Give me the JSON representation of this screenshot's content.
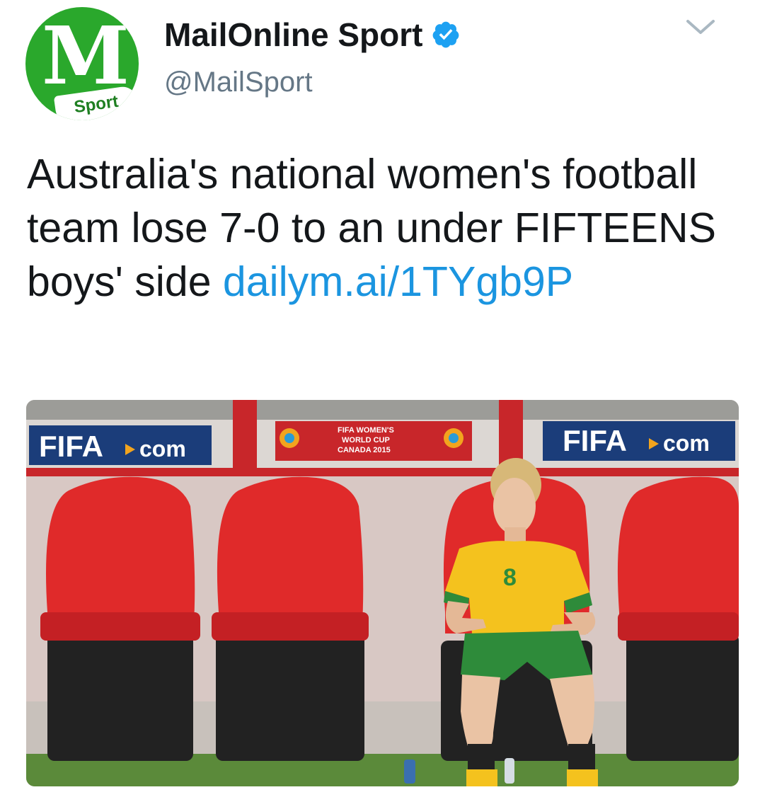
{
  "account": {
    "avatar_label": "Sport",
    "display_name": "MailOnline Sport",
    "handle": "@MailSport",
    "brand_color": "#2aa82c"
  },
  "tweet": {
    "text_before_link": "Australia's national women's football team lose 7-0 to an under FIFTEENS boys' side ",
    "link_text": "dailym.ai/​1TYgb9P",
    "link_color": "#1b95e0"
  },
  "photo": {
    "board_left": "FIFA",
    "board_left_suffix": "com",
    "board_right": "FIFA",
    "board_right_suffix": "com",
    "board_center_line1": "FIFA WOMEN'S",
    "board_center_line2": "WORLD CUP",
    "board_center_line3": "CANADA 2015",
    "jersey_number": "8"
  },
  "icons": {
    "verified": "verified-badge-icon",
    "menu": "chevron-down-icon"
  }
}
